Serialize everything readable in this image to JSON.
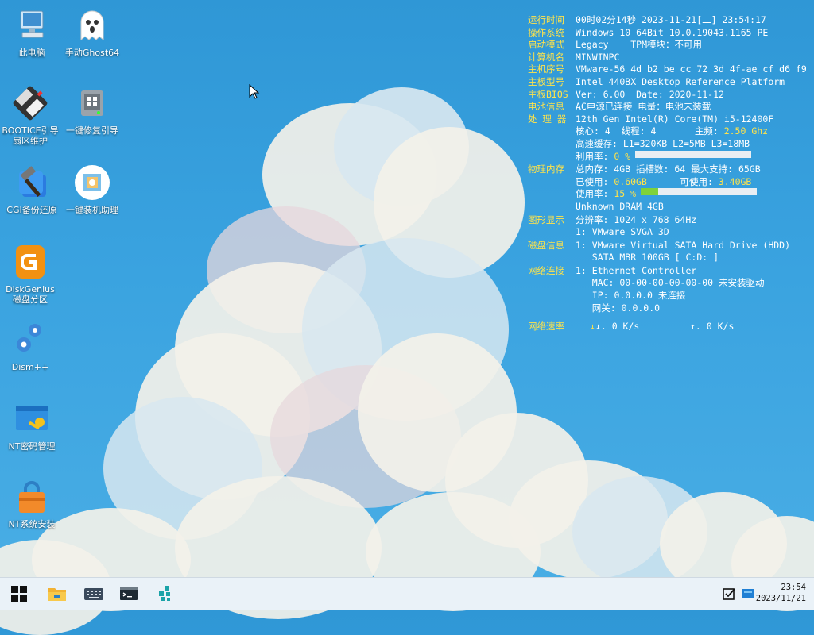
{
  "desktop_icons": [
    {
      "label": "此电脑",
      "icon": "computer-icon"
    },
    {
      "label": "手动Ghost64",
      "icon": "ghost-icon"
    },
    {
      "label": "BOOTICE引导扇区维护",
      "icon": "floppy-icon"
    },
    {
      "label": "一键修复引导",
      "icon": "drive-repair-icon"
    },
    {
      "label": "CGI备份还原",
      "icon": "hammer-icon"
    },
    {
      "label": "一键装机助理",
      "icon": "assistant-icon"
    },
    {
      "label": "DiskGenius磁盘分区",
      "icon": "diskgenius-icon"
    },
    {
      "label": "Dism++",
      "icon": "gears-icon"
    },
    {
      "label": "NT密码管理",
      "icon": "key-window-icon"
    },
    {
      "label": "NT系统安装",
      "icon": "lock-bag-icon"
    }
  ],
  "sysinfo": {
    "runtime_key": "运行时间",
    "runtime_val": "00时02分14秒 2023-11-21[二] 23:54:17",
    "os_key": "操作系统",
    "os_val": "Windows 10 64Bit 10.0.19043.1165 PE",
    "boot_key": "启动模式",
    "boot_val": "Legacy    TPM模块：不可用",
    "host_key": "计算机名",
    "host_val": "MINWINPC",
    "serial_key": "主机序号",
    "serial_val": "VMware-56 4d b2 be cc 72 3d 4f-ae cf d6 f9",
    "board_key": "主板型号",
    "board_val": "Intel 440BX Desktop Reference Platform",
    "bios_key": "主板BIOS",
    "bios_val": "Ver: 6.00  Date: 2020-11-12",
    "battery_key": "电池信息",
    "battery_val": "AC电源已连接 电量：电池未装载",
    "cpu_key": "处 理 器",
    "cpu_val": "12th Gen Intel(R) Core(TM) i5-12400F",
    "cpu_cores": "核心: 4  线程: 4       主频: ",
    "cpu_freq": "2.50 Ghz",
    "cpu_cache": "高速缓存: L1=320KB L2=5MB L3=18MB",
    "cpu_usage_label": "利用率: ",
    "cpu_usage": "0 %",
    "cpu_usage_fraction": 0.0,
    "mem_key": "物理内存",
    "mem_total": "总内存: 4GB 插槽数: 64 最大支持: 65GB",
    "mem_used_label": "已使用: ",
    "mem_used": "0.60GB",
    "mem_avail_label": "      可使用: ",
    "mem_avail": "3.40GB",
    "mem_usage_label": "使用率: ",
    "mem_usage": "15 %",
    "mem_usage_fraction": 0.15,
    "mem_type": "Unknown DRAM 4GB",
    "gfx_key": "图形显示",
    "gfx_res": "分辨率: 1024 x 768 64Hz",
    "gfx_card": "1: VMware SVGA 3D",
    "disk_key": "磁盘信息",
    "disk_1": "1: VMware Virtual SATA Hard Drive (HDD)",
    "disk_2": "   SATA MBR 100GB [ C:D: ]",
    "net_key": "网络连接",
    "net_1": "1: Ethernet Controller",
    "net_2": "   MAC: 00-00-00-00-00-00 未安装驱动",
    "net_3": "   IP: 0.0.0.0 未连接",
    "net_4": "   网关: 0.0.0.0",
    "speed_key": "网络速率",
    "speed_down": "↓. 0 K/s",
    "speed_up": "↑. 0 K/s"
  },
  "taskbar": {
    "time": "23:54",
    "date": "2023/11/21",
    "buttons": [
      "start-icon",
      "file-explorer-icon",
      "keyboard-icon",
      "terminal-icon",
      "network-tool-icon"
    ]
  },
  "colors": {
    "accent": "#ffe34a",
    "bar_fill": "#7fd23a",
    "taskbar": "#eaf2f8"
  }
}
